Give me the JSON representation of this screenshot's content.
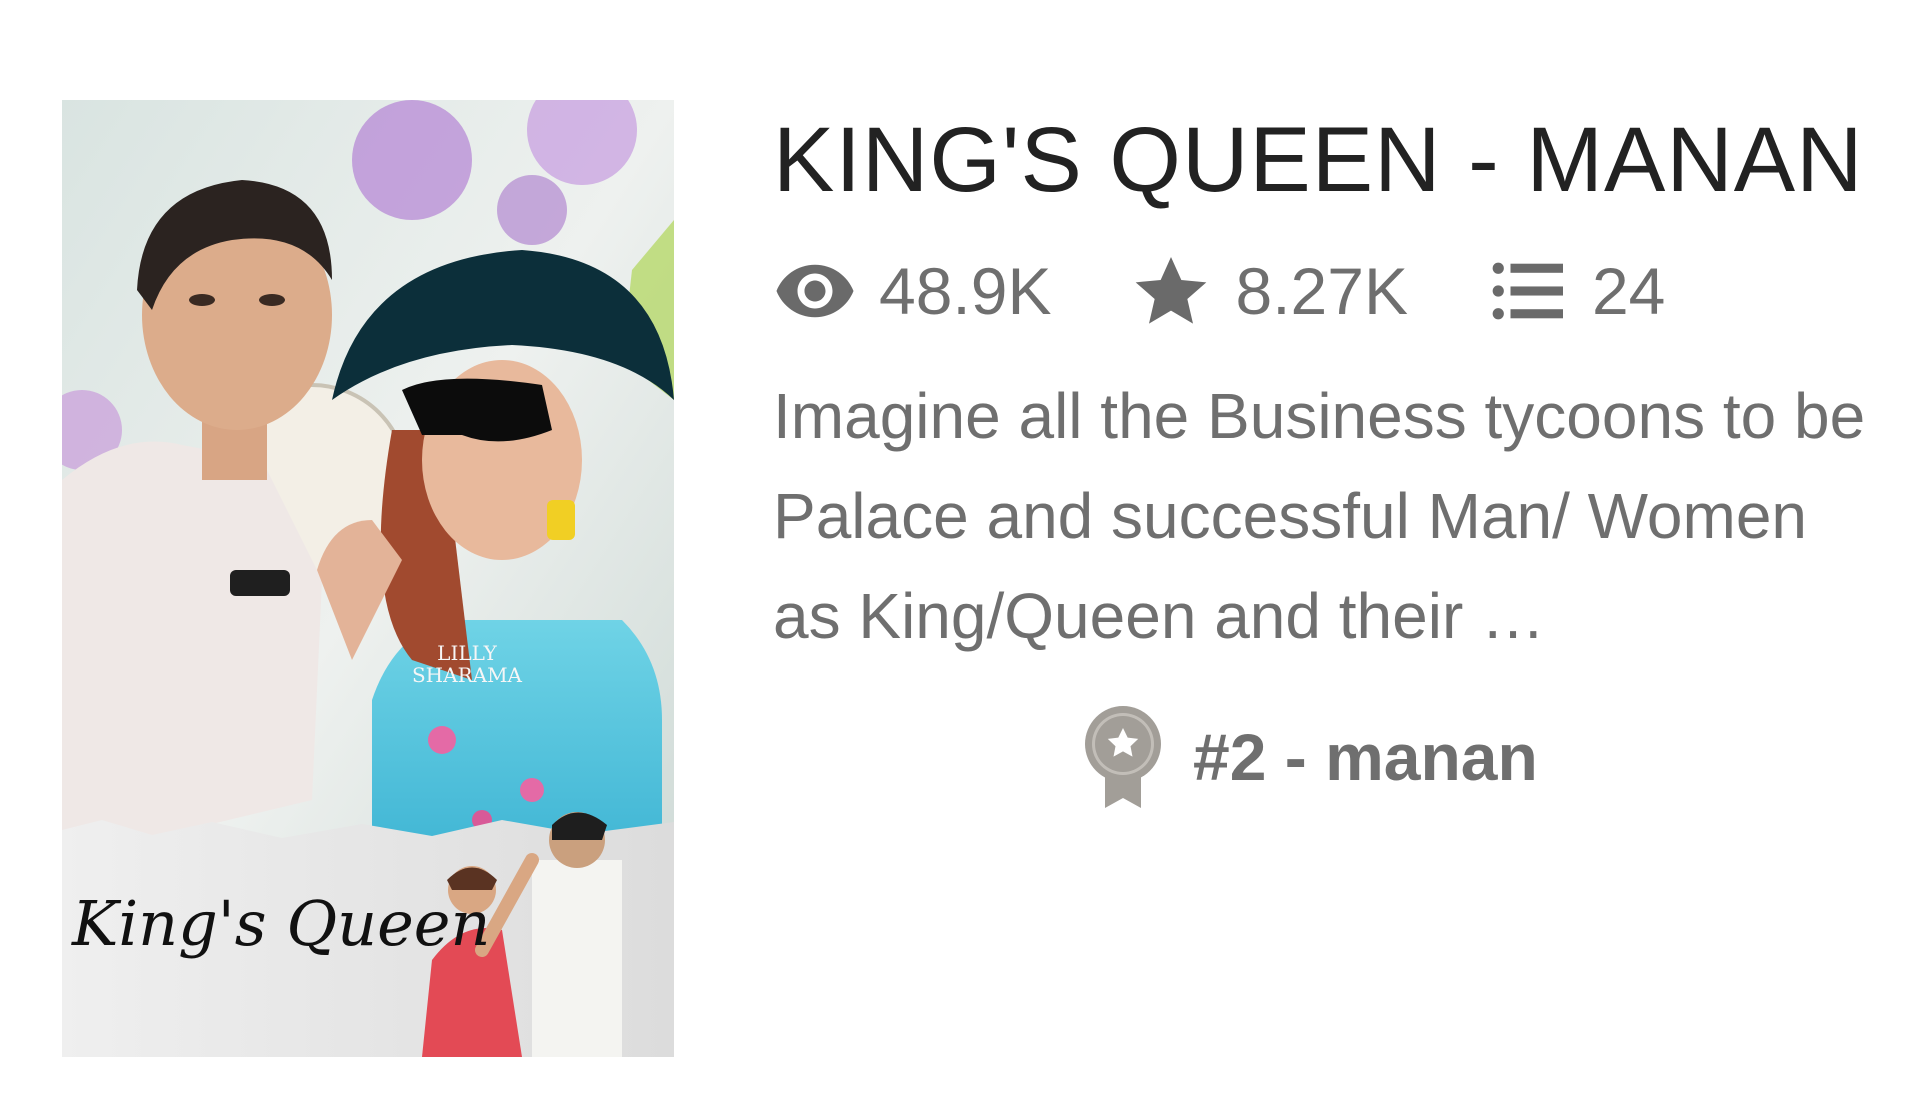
{
  "story": {
    "title": "KING'S QUEEN - MANAN",
    "cover": {
      "script_title": "King's Queen",
      "watermark_line1": "LILLY",
      "watermark_line2": "SHARAMA"
    },
    "stats": {
      "reads": "48.9K",
      "reads_icon": "eye-icon",
      "votes": "8.27K",
      "votes_icon": "star-icon",
      "parts": "24",
      "parts_icon": "list-icon"
    },
    "description": "Imagine all the Business tycoons to be Palace and successful Man/ Women as King/Queen and their …",
    "ranking": {
      "icon": "ribbon-badge-icon",
      "text": "#2 - manan"
    }
  },
  "colors": {
    "title": "#222222",
    "meta": "#6f6f6f",
    "icon": "#6a6a6a",
    "badge": "#a29e98"
  }
}
